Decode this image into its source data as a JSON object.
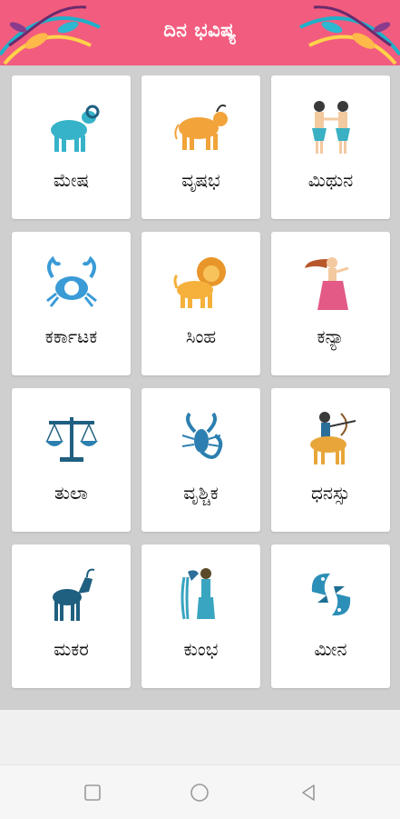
{
  "header": {
    "title": "ದಿನ ಭವಿಷ್ಯ"
  },
  "signs": [
    {
      "label": "ಮೇಷ",
      "icon": "ram-icon",
      "color": "#36b3c9"
    },
    {
      "label": "ವೃಷಭ",
      "icon": "bull-icon",
      "color": "#f2a33a"
    },
    {
      "label": "ಮಿಥುನ",
      "icon": "twins-icon",
      "color": "#3ab0c4"
    },
    {
      "label": "ಕರ್ಕಾಟಕ",
      "icon": "crab-icon",
      "color": "#3a9bd6"
    },
    {
      "label": "ಸಿಂಹ",
      "icon": "lion-icon",
      "color": "#f5b13b"
    },
    {
      "label": "ಕನ್ಯಾ",
      "icon": "maiden-icon",
      "color": "#e35a86"
    },
    {
      "label": "ತುಲಾ",
      "icon": "scales-icon",
      "color": "#1f5f80"
    },
    {
      "label": "ವೃಶ್ಚಿಕ",
      "icon": "scorpion-icon",
      "color": "#2c7fb0"
    },
    {
      "label": "ಧನಸ್ಸು",
      "icon": "archer-icon",
      "color": "#e8a63a"
    },
    {
      "label": "ಮಕರ",
      "icon": "goat-icon",
      "color": "#1f5f80"
    },
    {
      "label": "ಕುಂಭ",
      "icon": "water-bearer-icon",
      "color": "#3aa5c0"
    },
    {
      "label": "ಮೀನ",
      "icon": "fish-icon",
      "color": "#2c8fb8"
    }
  ],
  "navbar": {
    "recent": "square-icon",
    "home": "circle-icon",
    "back": "triangle-back-icon"
  }
}
